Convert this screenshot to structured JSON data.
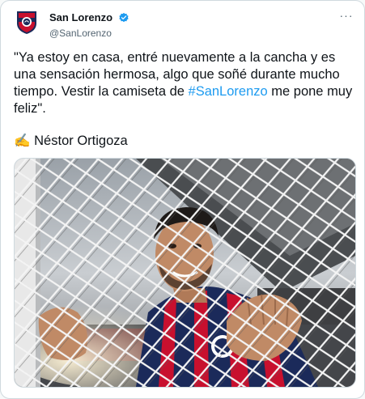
{
  "account": {
    "display_name": "San Lorenzo",
    "handle": "@SanLorenzo",
    "avatar_icon": "san-lorenzo-crest-icon",
    "verified_icon": "verified-badge-icon"
  },
  "menu": {
    "more_glyph": "···",
    "icon": "more-options-icon"
  },
  "tweet": {
    "text_part1": "\"Ya estoy en casa, entré nuevamente a la cancha y es una sensación hermosa, algo que soñé durante mucho tiempo. Vestir la camiseta de ",
    "hashtag": "#SanLorenzo",
    "text_part2": " me pone muy feliz\".",
    "signature_emoji": "✍️",
    "signature": "Néstor Ortigoza"
  },
  "media": {
    "description_icon": "photo-player-behind-net"
  },
  "colors": {
    "link": "#1d9bf0",
    "text": "#0f1419",
    "secondary": "#536471",
    "border": "#cfd9de",
    "club_blue": "#1b2a5a",
    "club_red": "#c8102e"
  }
}
